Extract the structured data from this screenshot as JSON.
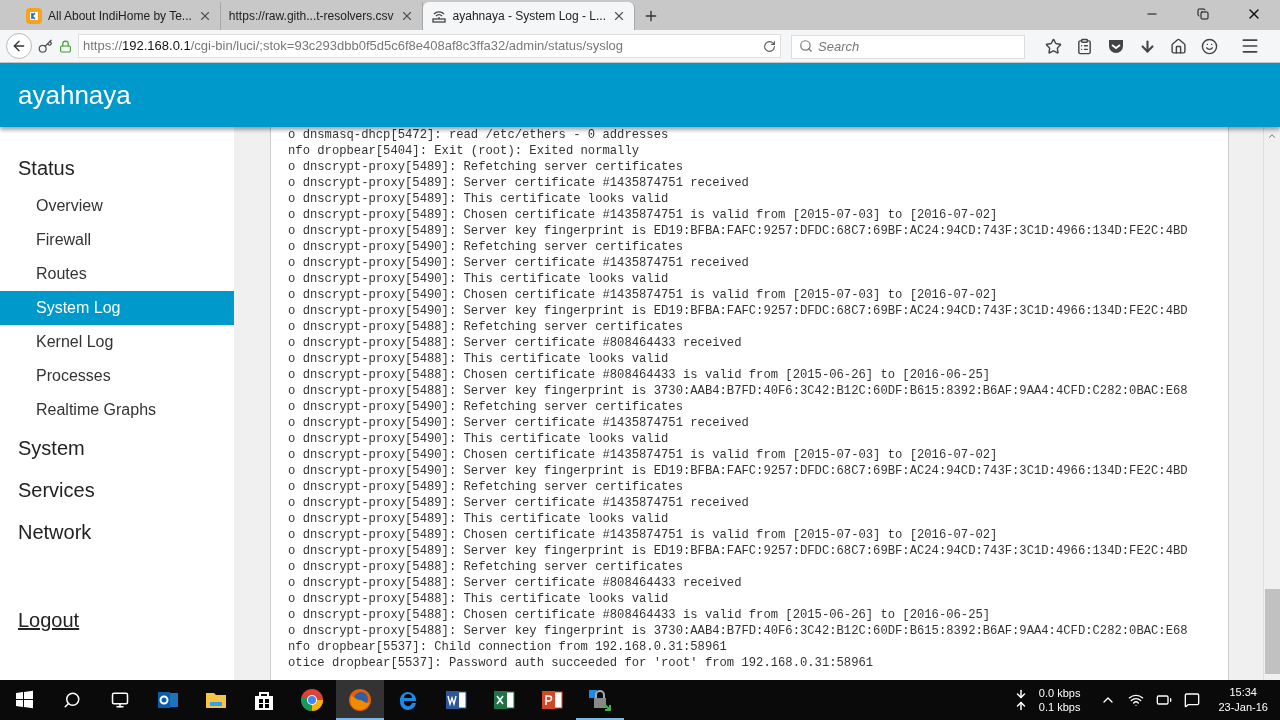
{
  "browser": {
    "tabs": [
      {
        "title": "All About IndiHome by Te...",
        "kind": "indihome",
        "selected": false
      },
      {
        "title": "https://raw.gith...t-resolvers.csv",
        "kind": "none",
        "selected": false
      },
      {
        "title": "ayahnaya - System Log - L...",
        "kind": "router",
        "selected": true
      }
    ],
    "url": {
      "scheme": "https://",
      "host": "192.168.0.1",
      "path": "/cgi-bin/luci/;stok=93c293dbb0f5d5c6f8e408af8c3ffa32/admin/status/syslog"
    },
    "search": {
      "placeholder": "Search"
    }
  },
  "header": {
    "title": "ayahnaya"
  },
  "sidebar": {
    "sections": [
      {
        "label": "Status",
        "children": [
          {
            "label": "Overview",
            "selected": false
          },
          {
            "label": "Firewall",
            "selected": false
          },
          {
            "label": "Routes",
            "selected": false
          },
          {
            "label": "System Log",
            "selected": true
          },
          {
            "label": "Kernel Log",
            "selected": false
          },
          {
            "label": "Processes",
            "selected": false
          },
          {
            "label": "Realtime Graphs",
            "selected": false
          }
        ]
      },
      {
        "label": "System"
      },
      {
        "label": "Services"
      },
      {
        "label": "Network"
      }
    ],
    "logout": "Logout"
  },
  "log_lines": [
    "o dnsmasq-dhcp[5472]: read /etc/ethers - 0 addresses",
    "nfo dropbear[5404]: Exit (root): Exited normally",
    "o dnscrypt-proxy[5489]: Refetching server certificates",
    "o dnscrypt-proxy[5489]: Server certificate #1435874751 received",
    "o dnscrypt-proxy[5489]: This certificate looks valid",
    "o dnscrypt-proxy[5489]: Chosen certificate #1435874751 is valid from [2015-07-03] to [2016-07-02]",
    "o dnscrypt-proxy[5489]: Server key fingerprint is ED19:BFBA:FAFC:9257:DFDC:68C7:69BF:AC24:94CD:743F:3C1D:4966:134D:FE2C:4BD",
    "o dnscrypt-proxy[5490]: Refetching server certificates",
    "o dnscrypt-proxy[5490]: Server certificate #1435874751 received",
    "o dnscrypt-proxy[5490]: This certificate looks valid",
    "o dnscrypt-proxy[5490]: Chosen certificate #1435874751 is valid from [2015-07-03] to [2016-07-02]",
    "o dnscrypt-proxy[5490]: Server key fingerprint is ED19:BFBA:FAFC:9257:DFDC:68C7:69BF:AC24:94CD:743F:3C1D:4966:134D:FE2C:4BD",
    "o dnscrypt-proxy[5488]: Refetching server certificates",
    "o dnscrypt-proxy[5488]: Server certificate #808464433 received",
    "o dnscrypt-proxy[5488]: This certificate looks valid",
    "o dnscrypt-proxy[5488]: Chosen certificate #808464433 is valid from [2015-06-26] to [2016-06-25]",
    "o dnscrypt-proxy[5488]: Server key fingerprint is 3730:AAB4:B7FD:40F6:3C42:B12C:60DF:B615:8392:B6AF:9AA4:4CFD:C282:0BAC:E68",
    "o dnscrypt-proxy[5490]: Refetching server certificates",
    "o dnscrypt-proxy[5490]: Server certificate #1435874751 received",
    "o dnscrypt-proxy[5490]: This certificate looks valid",
    "o dnscrypt-proxy[5490]: Chosen certificate #1435874751 is valid from [2015-07-03] to [2016-07-02]",
    "o dnscrypt-proxy[5490]: Server key fingerprint is ED19:BFBA:FAFC:9257:DFDC:68C7:69BF:AC24:94CD:743F:3C1D:4966:134D:FE2C:4BD",
    "o dnscrypt-proxy[5489]: Refetching server certificates",
    "o dnscrypt-proxy[5489]: Server certificate #1435874751 received",
    "o dnscrypt-proxy[5489]: This certificate looks valid",
    "o dnscrypt-proxy[5489]: Chosen certificate #1435874751 is valid from [2015-07-03] to [2016-07-02]",
    "o dnscrypt-proxy[5489]: Server key fingerprint is ED19:BFBA:FAFC:9257:DFDC:68C7:69BF:AC24:94CD:743F:3C1D:4966:134D:FE2C:4BD",
    "o dnscrypt-proxy[5488]: Refetching server certificates",
    "o dnscrypt-proxy[5488]: Server certificate #808464433 received",
    "o dnscrypt-proxy[5488]: This certificate looks valid",
    "o dnscrypt-proxy[5488]: Chosen certificate #808464433 is valid from [2015-06-26] to [2016-06-25]",
    "o dnscrypt-proxy[5488]: Server key fingerprint is 3730:AAB4:B7FD:40F6:3C42:B12C:60DF:B615:8392:B6AF:9AA4:4CFD:C282:0BAC:E68",
    "nfo dropbear[5537]: Child connection from 192.168.0.31:58961",
    "otice dropbear[5537]: Password auth succeeded for 'root' from 192.168.0.31:58961"
  ],
  "taskbar": {
    "apps": [
      {
        "kind": "outlook",
        "selected": false,
        "running": false
      },
      {
        "kind": "folder",
        "selected": false,
        "running": false
      },
      {
        "kind": "store",
        "selected": false,
        "running": false
      },
      {
        "kind": "chrome",
        "selected": false,
        "running": false
      },
      {
        "kind": "firefox",
        "selected": true,
        "running": true
      },
      {
        "kind": "edge",
        "selected": false,
        "running": false
      },
      {
        "kind": "word",
        "selected": false,
        "running": false
      },
      {
        "kind": "excel",
        "selected": false,
        "running": false
      },
      {
        "kind": "powerpoint",
        "selected": false,
        "running": false
      },
      {
        "kind": "vpn",
        "selected": false,
        "running": true
      }
    ],
    "download_rate": "0.0 kbps",
    "upload_rate": "0.1 kbps",
    "time": "15:34",
    "date": "23-Jan-16"
  }
}
